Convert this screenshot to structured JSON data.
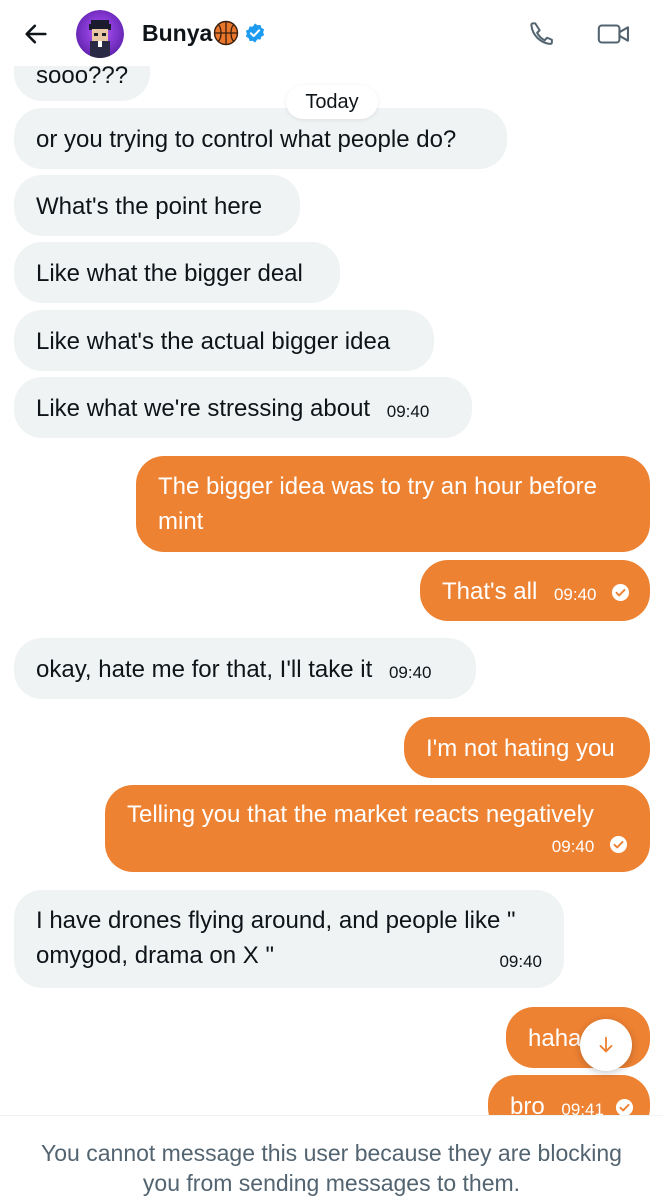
{
  "header": {
    "contact_name": "Bunya",
    "name_emoji_icon": "basketball-icon",
    "verified_icon": "verified-badge-icon",
    "back_icon": "back-arrow-icon",
    "call_icon": "phone-icon",
    "video_icon": "video-camera-icon",
    "avatar_icon": "avatar"
  },
  "conversation": {
    "date_divider": "Today",
    "messages": [
      {
        "direction": "incoming",
        "text": "sooo???",
        "time": ""
      },
      {
        "direction": "incoming",
        "text": "or you trying to control what people do?",
        "time": ""
      },
      {
        "direction": "incoming",
        "text": "What's the point here",
        "time": ""
      },
      {
        "direction": "incoming",
        "text": "Like what the bigger deal",
        "time": ""
      },
      {
        "direction": "incoming",
        "text": "Like what's the actual bigger idea",
        "time": ""
      },
      {
        "direction": "incoming",
        "text": "Like what we're stressing about",
        "time": "09:40"
      },
      {
        "direction": "outgoing",
        "text_line1": "The bigger idea was to try an hour before",
        "text_line2": "mint",
        "time": ""
      },
      {
        "direction": "outgoing",
        "text": "That's all",
        "time": "09:40",
        "status_icon": "read-check-icon"
      },
      {
        "direction": "incoming",
        "text": "okay, hate me for that, I'll take it",
        "time": "09:40"
      },
      {
        "direction": "outgoing",
        "text": "I'm not hating you",
        "time": ""
      },
      {
        "direction": "outgoing",
        "text": "Telling you that the market reacts negatively",
        "time": "09:40",
        "status_icon": "read-check-icon"
      },
      {
        "direction": "incoming",
        "text_line1": "I have drones flying around, and people like \"",
        "text_line2": "omygod, drama on X \"",
        "time": "09:40"
      },
      {
        "direction": "outgoing",
        "text": "haha",
        "time": ""
      },
      {
        "direction": "outgoing",
        "text": "bro",
        "time": "09:41",
        "status_icon": "read-check-icon"
      }
    ],
    "scroll_down_icon": "arrow-down-icon"
  },
  "footer": {
    "blocked_notice_line1": "You cannot message this user because they are blocking",
    "blocked_notice_line2": "you from sending messages to them."
  },
  "colors": {
    "outgoing_bubble": "#ee8233",
    "incoming_bubble": "#eff3f4",
    "verified_blue": "#1d9bf0",
    "secondary_text": "#536471"
  }
}
